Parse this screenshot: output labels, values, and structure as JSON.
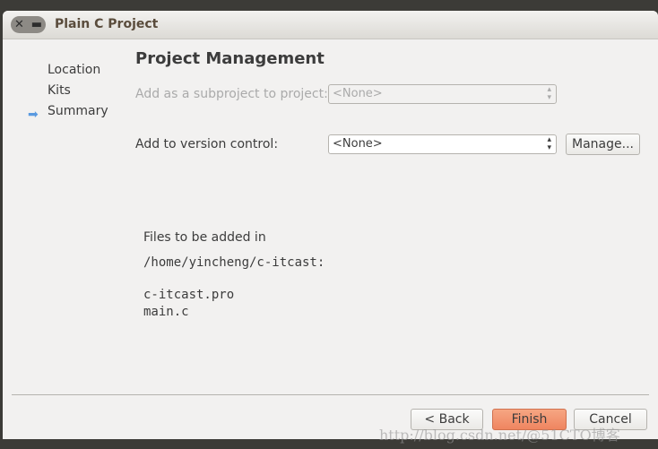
{
  "window": {
    "title": "Plain C Project"
  },
  "sidebar": {
    "items": [
      {
        "label": "Location"
      },
      {
        "label": "Kits"
      },
      {
        "label": "Summary",
        "current": true
      }
    ]
  },
  "page": {
    "title": "Project Management",
    "subproject_label": "Add as a subproject to project:",
    "subproject_value": "<None>",
    "vc_label": "Add to version control:",
    "vc_value": "<None>",
    "manage_label": "Manage...",
    "files_intro": "Files to be added in",
    "files_dir": "/home/yincheng/c-itcast:",
    "files": [
      "c-itcast.pro",
      "main.c"
    ]
  },
  "buttons": {
    "back": "< Back",
    "finish": "Finish",
    "cancel": "Cancel"
  },
  "colors": {
    "finish": "#f28c68",
    "arrow": "#5a9ae0"
  },
  "watermark": "http://blog.csdn.net/@51CTO博客"
}
